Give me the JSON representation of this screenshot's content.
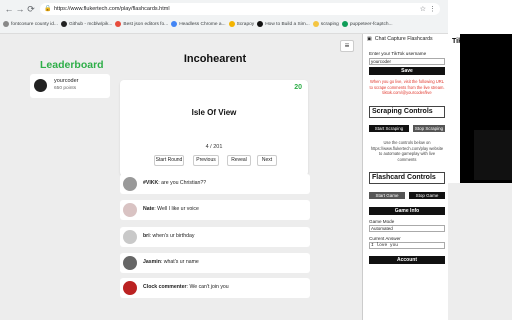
{
  "browser": {
    "url": "https://www.flukertech.com/play/flashcards.html",
    "bookmarks": [
      "fontcosure county id...",
      "Github - mcblw/pik...",
      "Best json editors fo...",
      "Headless Chrome a...",
      "Scrapoy",
      "How to Build a Sim...",
      "scraping",
      "puppeteer-fcaptch..."
    ]
  },
  "page": {
    "leaderboard_title": "Leaderboard",
    "user": {
      "name": "yourcoder",
      "points": "650 points"
    },
    "game_title": "Incohearent",
    "menu_icon": "hamburger-icon",
    "card": {
      "score": "20",
      "question": "Isle Of View"
    },
    "counter": "4 / 201",
    "controls": [
      "Start Round",
      "Previous",
      "Reveal",
      "Next"
    ],
    "chat": [
      {
        "user": "#VIKK",
        "text": "are you Christian??"
      },
      {
        "user": "Nate",
        "text": "Well I like ur voice"
      },
      {
        "user": "bri",
        "text": "when's ur birthday"
      },
      {
        "user": "Jasmin",
        "text": "what's ur name"
      },
      {
        "user": "Clock commenter",
        "text": "We can't join you"
      }
    ]
  },
  "extension": {
    "title": "Chat Capture Flashcards",
    "username_label": "Enter your TikTok username",
    "username_value": "yourcoder",
    "save_label": "Save",
    "note": "When you go live, visit the following URL to scrape comments from the live stream. tiktok.com/@yourcoder/live",
    "scraping_title": "Scraping Controls",
    "start_scraping": "Start Scraping",
    "stop_scraping": "Stop Scraping",
    "controls_note": "Use the controls below on https://www.flukertech.com/play website to automate gameplay with live comments",
    "flashcard_title": "Flashcard Controls",
    "start_game": "Start Game",
    "stop_game": "Stop Game",
    "game_info": "Game Info",
    "game_mode_label": "Game Mode",
    "game_mode_value": "Automated",
    "current_answer_label": "Current Answer",
    "current_answer_value": "I love you",
    "account": "Account"
  },
  "tiktok": {
    "title": "TikTok"
  }
}
